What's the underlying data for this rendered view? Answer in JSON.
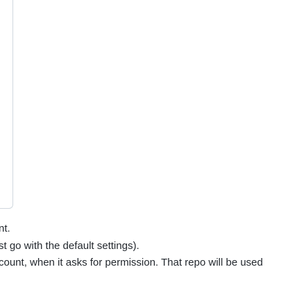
{
  "document": {
    "lines": [
      "nt.",
      "st go with the default settings).",
      "count, when it asks for permission. That repo will be used",
      "."
    ]
  }
}
